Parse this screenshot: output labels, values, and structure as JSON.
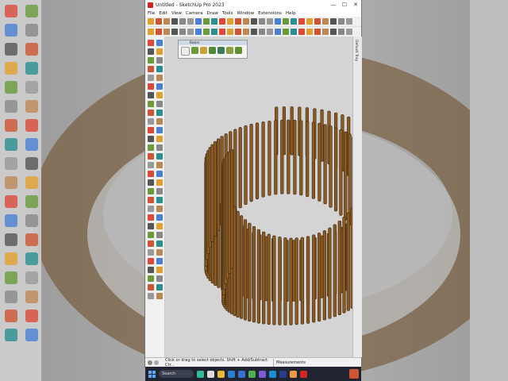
{
  "window": {
    "title": "Untitled - SketchUp Pro 2023",
    "minimize": "—",
    "maximize": "☐",
    "close": "✕"
  },
  "menu": [
    "File",
    "Edit",
    "View",
    "Camera",
    "Draw",
    "Tools",
    "Window",
    "Extensions",
    "Help"
  ],
  "floating_toolbar": {
    "title": "Bezier"
  },
  "tray_tab": {
    "label": "Default Tray"
  },
  "status": {
    "message": "Click or drag to select objects. Shift + Add/Subtract. Ctr...",
    "measurements_label": "Measurements"
  },
  "taskbar": {
    "search_label": "Search"
  },
  "colors": {
    "wood": "#8a5a25",
    "wood_dark": "#3d2810",
    "viewport_bg": "#d4d4d4",
    "accent_red": "#d4261f",
    "taskbar": "#1f2430"
  }
}
